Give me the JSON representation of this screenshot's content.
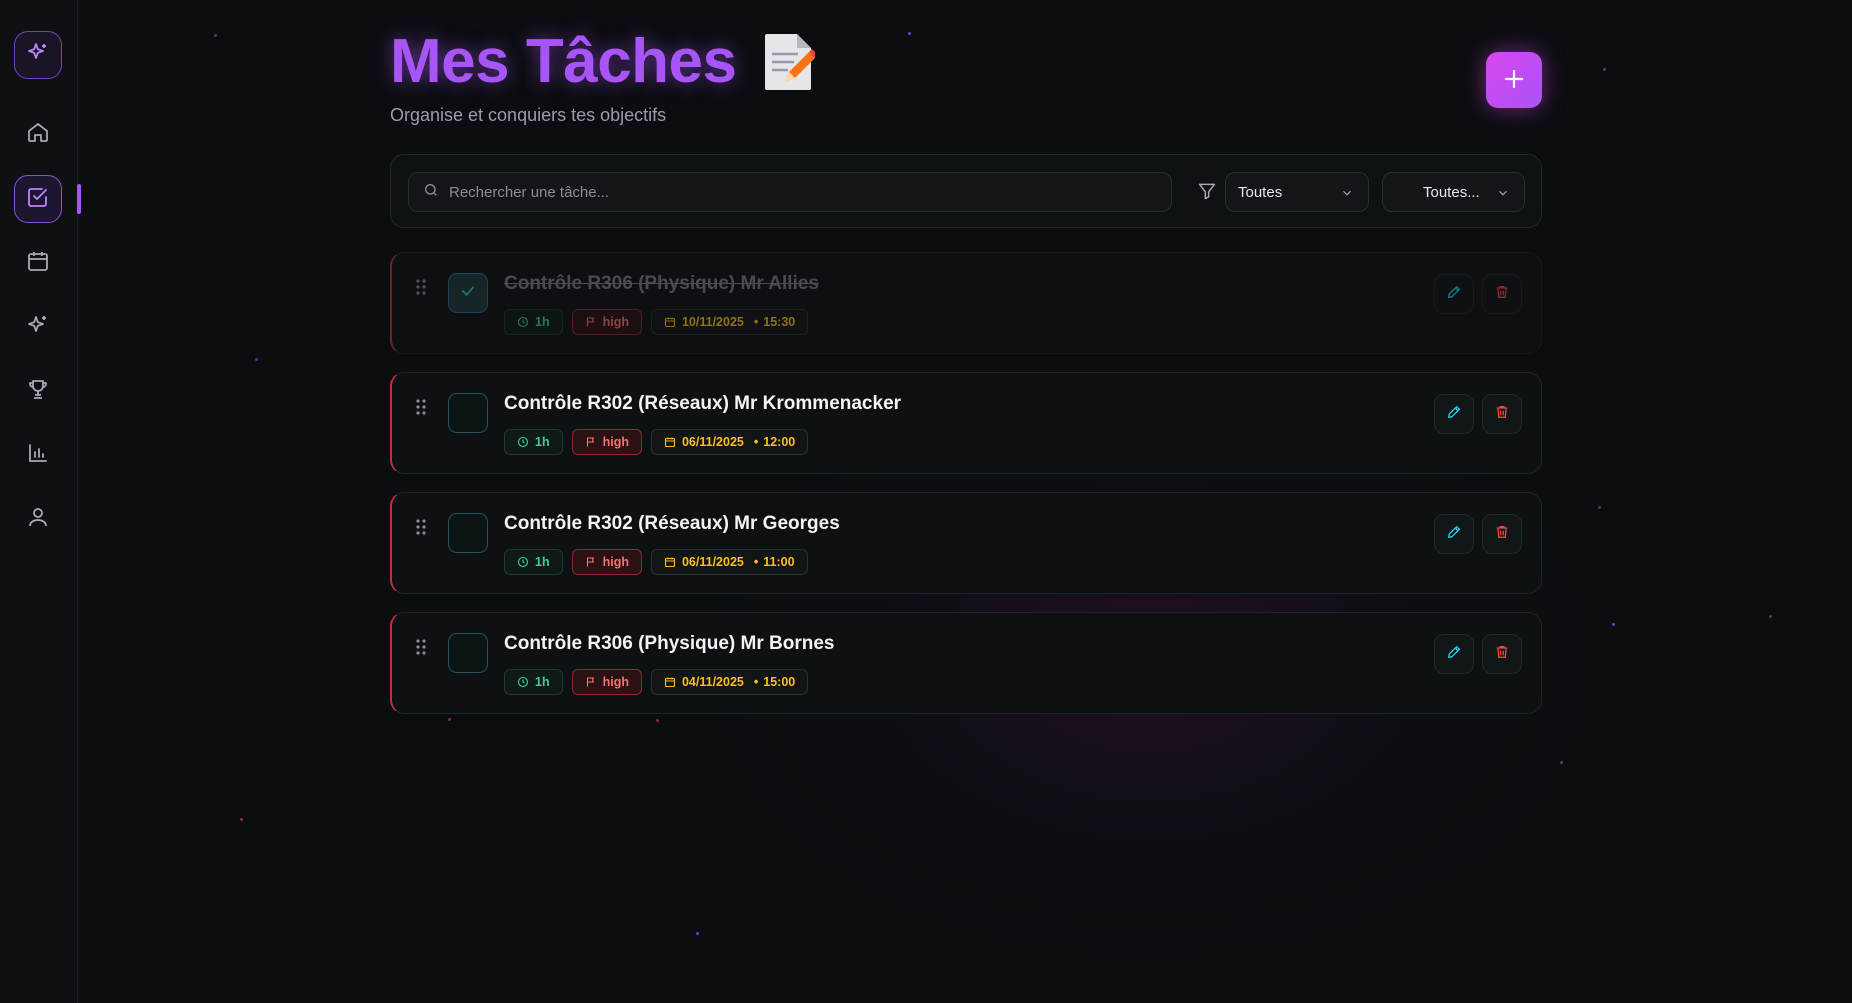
{
  "header": {
    "title": "Mes Tâches",
    "subtitle": "Organise et conquiers tes objectifs",
    "add_label": "+"
  },
  "filters": {
    "search_placeholder": "Rechercher une tâche...",
    "status_selected": "Toutes",
    "priority_selected": "Toutes..."
  },
  "tasks": [
    {
      "title": "Contrôle R306 (Physique) Mr Allies",
      "duration": "1h",
      "priority": "high",
      "date": "10/11/2025",
      "time": "15:30",
      "completed": true
    },
    {
      "title": "Contrôle R302 (Réseaux) Mr Krommenacker",
      "duration": "1h",
      "priority": "high",
      "date": "06/11/2025",
      "time": "12:00",
      "completed": false
    },
    {
      "title": "Contrôle R302 (Réseaux) Mr Georges",
      "duration": "1h",
      "priority": "high",
      "date": "06/11/2025",
      "time": "11:00",
      "completed": false
    },
    {
      "title": "Contrôle R306 (Physique) Mr Bornes",
      "duration": "1h",
      "priority": "high",
      "date": "04/11/2025",
      "time": "15:00",
      "completed": false
    }
  ],
  "sidebar": {
    "items": [
      {
        "icon": "sparkles-icon"
      },
      {
        "icon": "home-icon"
      },
      {
        "icon": "checkbox-icon",
        "active": true
      },
      {
        "icon": "calendar-icon"
      },
      {
        "icon": "sparkles-icon"
      },
      {
        "icon": "trophy-icon"
      },
      {
        "icon": "bar-chart-icon"
      },
      {
        "icon": "user-icon"
      }
    ]
  },
  "colors": {
    "accent": "#a855f7",
    "add_button": "#d946ef",
    "priority_high": "#f87171",
    "duration": "#34d399",
    "date": "#fbbf24",
    "edit": "#22d3ee",
    "delete": "#ef4444"
  }
}
